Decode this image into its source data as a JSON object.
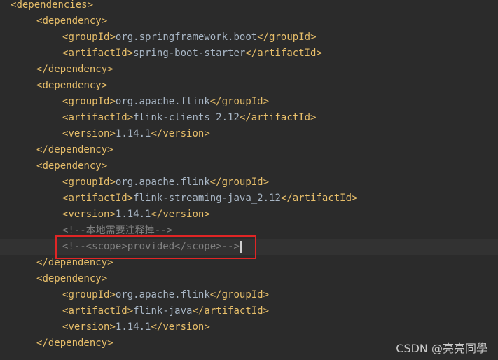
{
  "editor": {
    "lines": [
      {
        "indent": 0,
        "kind": "open",
        "tag": "dependencies"
      },
      {
        "indent": 1,
        "kind": "open",
        "tag": "dependency"
      },
      {
        "indent": 2,
        "kind": "element",
        "tag": "groupId",
        "value": "org.springframework.boot"
      },
      {
        "indent": 2,
        "kind": "element",
        "tag": "artifactId",
        "value": "spring-boot-starter"
      },
      {
        "indent": 1,
        "kind": "close",
        "tag": "dependency"
      },
      {
        "indent": 1,
        "kind": "open",
        "tag": "dependency"
      },
      {
        "indent": 2,
        "kind": "element",
        "tag": "groupId",
        "value": "org.apache.flink"
      },
      {
        "indent": 2,
        "kind": "element",
        "tag": "artifactId",
        "value": "flink-clients_2.12"
      },
      {
        "indent": 2,
        "kind": "element",
        "tag": "version",
        "value": "1.14.1"
      },
      {
        "indent": 1,
        "kind": "close",
        "tag": "dependency"
      },
      {
        "indent": 1,
        "kind": "open",
        "tag": "dependency"
      },
      {
        "indent": 2,
        "kind": "element",
        "tag": "groupId",
        "value": "org.apache.flink"
      },
      {
        "indent": 2,
        "kind": "element",
        "tag": "artifactId",
        "value": "flink-streaming-java_2.12"
      },
      {
        "indent": 2,
        "kind": "element",
        "tag": "version",
        "value": "1.14.1"
      },
      {
        "indent": 2,
        "kind": "comment",
        "text": "<!--本地需要注释掉-->"
      },
      {
        "indent": 2,
        "kind": "comment",
        "text": "<!--<scope>provided</scope>-->",
        "current": true,
        "highlighted": true
      },
      {
        "indent": 1,
        "kind": "close",
        "tag": "dependency"
      },
      {
        "indent": 1,
        "kind": "open",
        "tag": "dependency"
      },
      {
        "indent": 2,
        "kind": "element",
        "tag": "groupId",
        "value": "org.apache.flink"
      },
      {
        "indent": 2,
        "kind": "element",
        "tag": "artifactId",
        "value": "flink-java"
      },
      {
        "indent": 2,
        "kind": "element",
        "tag": "version",
        "value": "1.14.1"
      },
      {
        "indent": 1,
        "kind": "close",
        "tag": "dependency"
      }
    ]
  },
  "watermark": "CSDN @亮亮同學",
  "colors": {
    "background": "#2b2b2b",
    "bracket": "#e8bf6a",
    "tag": "#e8bf6a",
    "text": "#a9b7c6",
    "comment": "#808080",
    "highlight_box": "#e02525"
  }
}
